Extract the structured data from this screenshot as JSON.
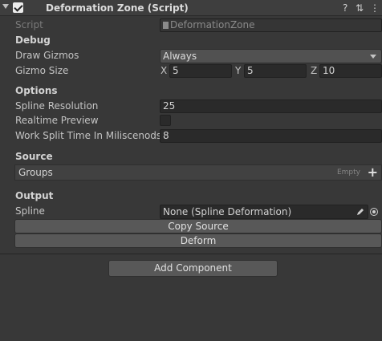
{
  "component": {
    "title": "Deformation Zone (Script)",
    "script_label": "Script",
    "script_value": "DeformationZone"
  },
  "debug": {
    "heading": "Debug",
    "draw_gizmos_label": "Draw Gizmos",
    "draw_gizmos_value": "Always",
    "gizmo_size_label": "Gizmo Size",
    "x_label": "X",
    "x_value": "5",
    "y_label": "Y",
    "y_value": "5",
    "z_label": "Z",
    "z_value": "10"
  },
  "options": {
    "heading": "Options",
    "spline_resolution_label": "Spline Resolution",
    "spline_resolution_value": "25",
    "realtime_preview_label": "Realtime Preview",
    "work_split_label": "Work Split Time In Miliscenods",
    "work_split_value": "8"
  },
  "source": {
    "heading": "Source",
    "groups_label": "Groups",
    "groups_empty": "Empty",
    "add_symbol": "+"
  },
  "output": {
    "heading": "Output",
    "spline_label": "Spline",
    "spline_value": "None (Spline Deformation)"
  },
  "buttons": {
    "copy_source": "Copy Source",
    "deform": "Deform",
    "add_component": "Add Component"
  },
  "icons": {
    "help": "?",
    "settings": "⇅",
    "more": "⋮"
  }
}
